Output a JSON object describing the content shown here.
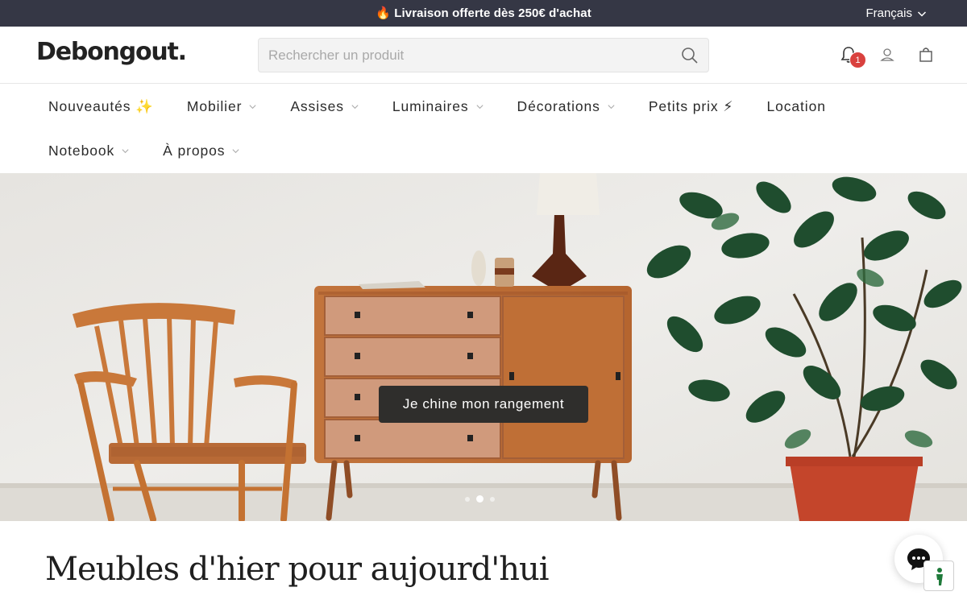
{
  "announcement": {
    "text": "🔥 Livraison offerte dès 250€ d'achat",
    "language": "Français"
  },
  "header": {
    "logo": "Debongout.",
    "search_placeholder": "Rechercher un produit",
    "notification_count": "1",
    "icons": [
      "bell-icon",
      "account-icon",
      "bag-icon",
      "search-icon"
    ]
  },
  "nav": {
    "row1": [
      {
        "label": "Nouveautés ✨",
        "dropdown": false
      },
      {
        "label": "Mobilier",
        "dropdown": true
      },
      {
        "label": "Assises",
        "dropdown": true
      },
      {
        "label": "Luminaires",
        "dropdown": true
      },
      {
        "label": "Décorations",
        "dropdown": true
      },
      {
        "label": "Petits prix ⚡",
        "dropdown": false
      },
      {
        "label": "Location",
        "dropdown": false
      }
    ],
    "row2": [
      {
        "label": "Notebook",
        "dropdown": true
      },
      {
        "label": "À propos",
        "dropdown": true
      }
    ]
  },
  "hero": {
    "cta_label": "Je chine mon rangement",
    "slides_count": 3,
    "active_slide": 2
  },
  "main": {
    "headline": "Meubles d'hier pour aujourd'hui"
  },
  "colors": {
    "announce_bg": "#353745",
    "badge": "#d9413e",
    "cta_bg": "#2f2e2c",
    "accessibility_green": "#1f7a3a"
  }
}
